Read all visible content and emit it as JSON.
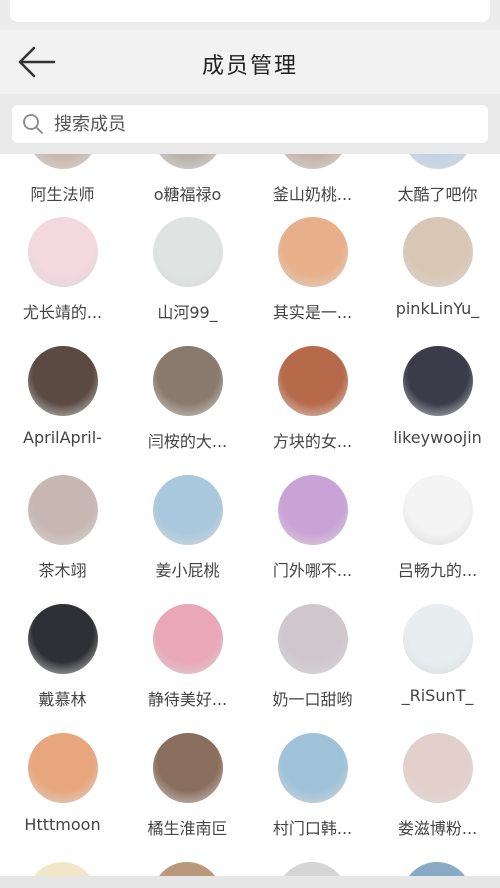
{
  "header": {
    "title": "成员管理"
  },
  "search": {
    "placeholder": "搜索成员"
  },
  "members": [
    {
      "name": "阿生法师"
    },
    {
      "name": "o糖福禄o"
    },
    {
      "name": "釜山奶桃..."
    },
    {
      "name": "太酷了吧你"
    },
    {
      "name": "尤长靖的..."
    },
    {
      "name": "山河99_"
    },
    {
      "name": "其实是一..."
    },
    {
      "name": "pinkLinYu_"
    },
    {
      "name": "AprilApril-"
    },
    {
      "name": "闫桉的大..."
    },
    {
      "name": "方块的女..."
    },
    {
      "name": "likeywoojin"
    },
    {
      "name": "茶木翊"
    },
    {
      "name": "姜小屁桃"
    },
    {
      "name": "门外哪不..."
    },
    {
      "name": "吕畅九的..."
    },
    {
      "name": "戴慕林"
    },
    {
      "name": "静待美好..."
    },
    {
      "name": "奶一口甜哟"
    },
    {
      "name": "_RiSunT_"
    },
    {
      "name": "Htttmoon"
    },
    {
      "name": "橘生淮南叵"
    },
    {
      "name": "村门口韩..."
    },
    {
      "name": "娄滋博粉..."
    }
  ],
  "avatar_colors": [
    "#c9b8ad",
    "#b9b2a8",
    "#c4b4a8",
    "#c2d3e6",
    "#f3d8e0",
    "#dfe4e2",
    "#e8b08a",
    "#d9c7b5",
    "#5a4a42",
    "#8a7a6e",
    "#b76a4a",
    "#3b3b4a",
    "#c7b7b3",
    "#a9c8dd",
    "#c9a2d6",
    "#f4f4f4",
    "#2f3035",
    "#e9a7b8",
    "#cfc7cc",
    "#e8eef0",
    "#e8a67d",
    "#8a6e5d",
    "#9fc2d8",
    "#e3d0cc"
  ]
}
